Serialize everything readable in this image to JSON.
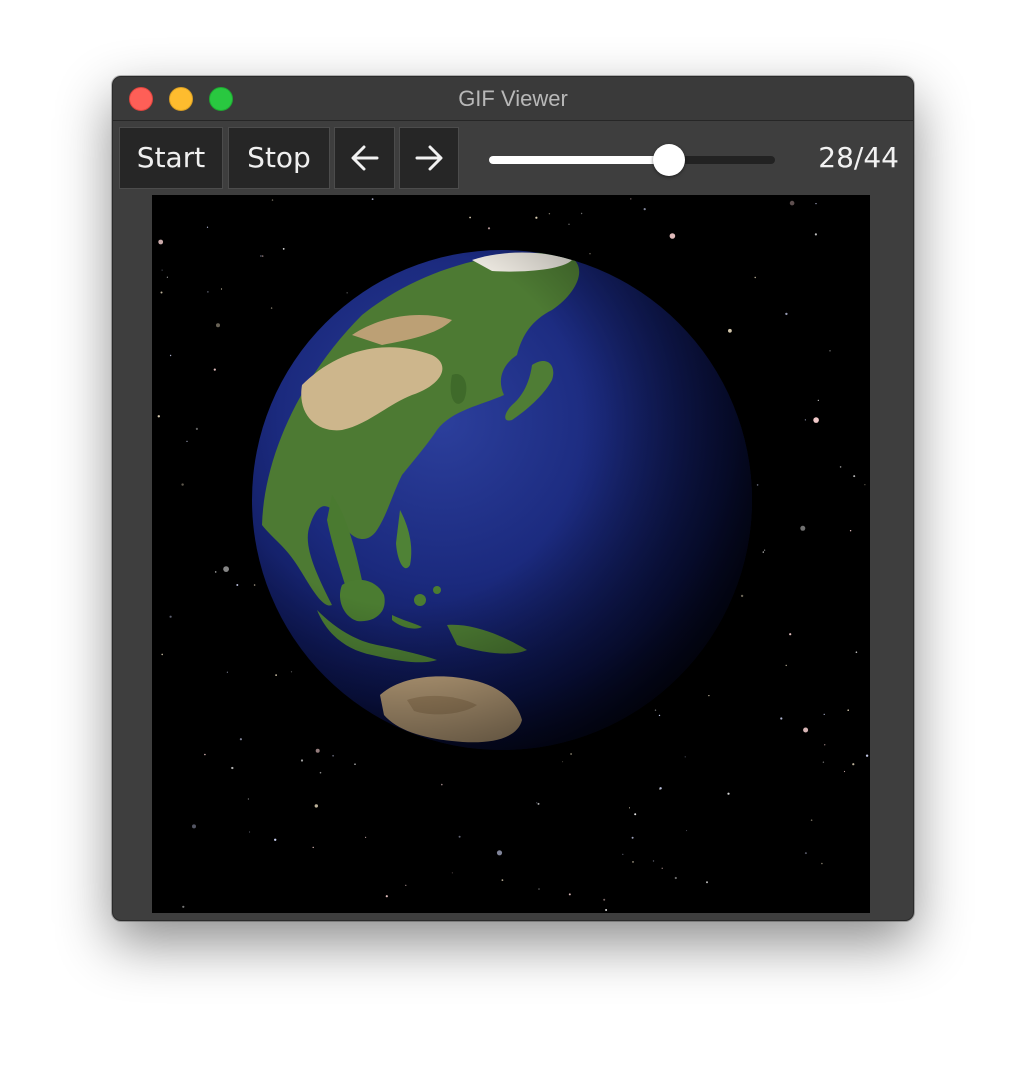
{
  "window": {
    "title": "GIF Viewer"
  },
  "toolbar": {
    "start_label": "Start",
    "stop_label": "Stop",
    "prev_icon": "arrow-left-icon",
    "next_icon": "arrow-right-icon"
  },
  "playback": {
    "current_frame": 28,
    "total_frames": 44,
    "frame_label": "28/44"
  },
  "colors": {
    "window_bg": "#3e3e3e",
    "button_bg": "#262626",
    "close": "#fe5f57",
    "minimize": "#febc2e",
    "maximize": "#29c840"
  }
}
